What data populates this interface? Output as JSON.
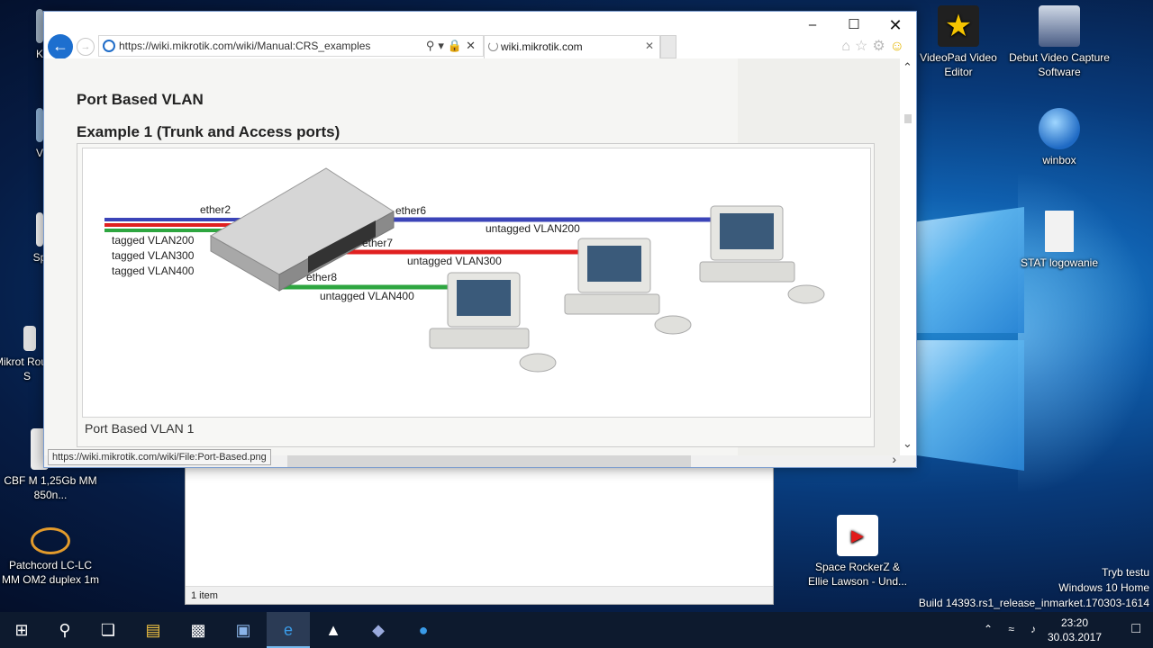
{
  "browser": {
    "url": "https://wiki.mikrotik.com/wiki/Manual:CRS_examples",
    "tab_title": "wiki.mikrotik.com",
    "status_url": "https://wiki.mikrotik.com/wiki/File:Port-Based.png"
  },
  "page": {
    "heading": "Port Based VLAN",
    "subheading": "Example 1 (Trunk and Access ports)",
    "caption": "Port Based VLAN 1"
  },
  "diagram": {
    "labels": {
      "ether2": "ether2",
      "ether6": "ether6",
      "ether7": "ether7",
      "ether8": "ether8",
      "tagged200": "tagged VLAN200",
      "tagged300": "tagged VLAN300",
      "tagged400": "tagged VLAN400",
      "untagged200": "untagged VLAN200",
      "untagged300": "untagged VLAN300",
      "untagged400": "untagged VLAN400"
    },
    "colors": {
      "vlan200": "#3b44b8",
      "vlan300": "#e02020",
      "vlan400": "#2ea640"
    }
  },
  "explorer": {
    "status": "1 item"
  },
  "desktop_icons": {
    "videopad": "VideoPad Video Editor",
    "debut": "Debut Video Capture Software",
    "winbox": "winbox",
    "stat": "STAT logowanie",
    "mikrotik": "Mikrot Router S",
    "cbf": "CBF M 1,25Gb MM 850n...",
    "patchcord": "Patchcord LC-LC MM OM2 duplex 1m",
    "space": "Space RockerZ & Ellie Lawson - Und...",
    "sp": "Sp",
    "k": "K",
    "v": "V"
  },
  "watermark": {
    "line1": "Tryb testu",
    "line2": "Windows 10 Home",
    "line3": "Build 14393.rs1_release_inmarket.170303-1614"
  },
  "clock": {
    "time": "23:20",
    "date": "30.03.2017"
  }
}
